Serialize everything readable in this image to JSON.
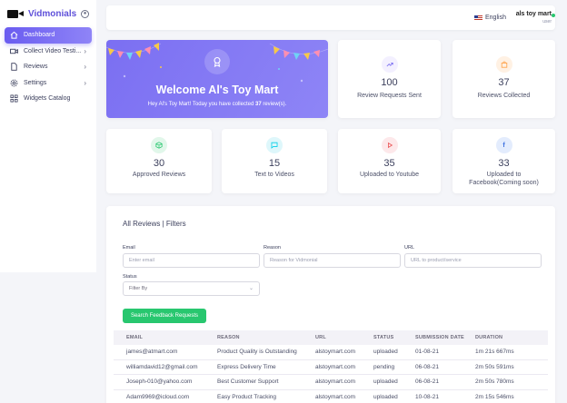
{
  "brand": {
    "name": "Vidmonials",
    "collapse_icon": "circle-dot-icon"
  },
  "sidebar": {
    "items": [
      {
        "label": "Dashboard",
        "icon": "home-icon",
        "active": true,
        "chevron": false
      },
      {
        "label": "Collect Video Testi...",
        "icon": "video-icon",
        "active": false,
        "chevron": true
      },
      {
        "label": "Reviews",
        "icon": "file-icon",
        "active": false,
        "chevron": true
      },
      {
        "label": "Settings",
        "icon": "gear-icon",
        "active": false,
        "chevron": true
      },
      {
        "label": "Widgets Catalog",
        "icon": "grid-icon",
        "active": false,
        "chevron": false
      }
    ]
  },
  "header": {
    "language": "English",
    "user_name": "als toy mart",
    "user_role": "user"
  },
  "welcome": {
    "title": "Welcome Al's Toy Mart",
    "subtitle_prefix": "Hey Al's Toy Mart! Today you have collected ",
    "count": "37",
    "subtitle_suffix": " review(s)."
  },
  "stats": {
    "requests_sent": {
      "value": "100",
      "label": "Review Requests Sent",
      "color": "#f3f0ff"
    },
    "reviews_collected": {
      "value": "37",
      "label": "Reviews Collected",
      "color": "#fff1e3"
    },
    "approved": {
      "value": "30",
      "label": "Approved Reviews",
      "color": "#e1f7ea"
    },
    "text_to_videos": {
      "value": "15",
      "label": "Text to Videos",
      "color": "#def7fb"
    },
    "youtube": {
      "value": "35",
      "label": "Uploaded to Youtube",
      "color": "#fde8ea"
    },
    "facebook": {
      "value": "33",
      "label_line1": "Uploaded to",
      "label_line2": "Facebook(Coming soon)",
      "color": "#e3ecfd"
    }
  },
  "filters": {
    "title": "All Reviews | Filters",
    "email_label": "Email",
    "email_placeholder": "Enter email",
    "reason_label": "Reason",
    "reason_placeholder": "Reason for Vidmonial",
    "url_label": "URL",
    "url_placeholder": "URL to product/service",
    "status_label": "Status",
    "status_value": "Filter By",
    "search_button": "Search Feedback Requests"
  },
  "table": {
    "headers": [
      "EMAIL",
      "REASON",
      "URL",
      "STATUS",
      "SUBMISSION DATE",
      "DURATION"
    ],
    "rows": [
      [
        "james@atmart.com",
        "Product Quality is Outstanding",
        "alstoymart.com",
        "uploaded",
        "01-08-21",
        "1m 21s 667ms"
      ],
      [
        "williamdavid12@gmail.com",
        "Express Delivery Time",
        "alstoymart.com",
        "pending",
        "06-08-21",
        "2m 50s 591ms"
      ],
      [
        "Joseph-010@yahoo.com",
        "Best Customer Support",
        "alstoymart.com",
        "uploaded",
        "06-08-21",
        "2m 50s 780ms"
      ],
      [
        "Adam9969@icloud.com",
        "Easy Product Tracking",
        "alstoymart.com",
        "uploaded",
        "10-08-21",
        "2m 15s 546ms"
      ]
    ]
  }
}
